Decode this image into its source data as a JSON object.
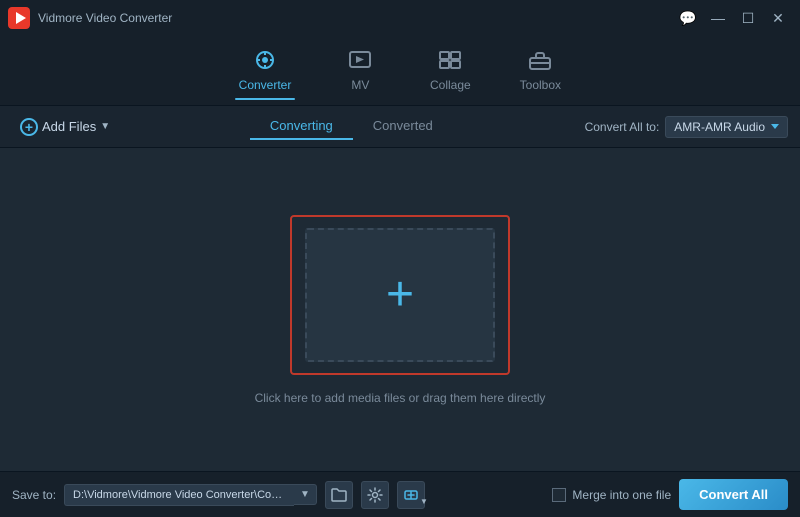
{
  "titlebar": {
    "app_name": "Vidmore Video Converter",
    "controls": {
      "message": "💬",
      "minimize": "—",
      "maximize": "☐",
      "close": "✕"
    }
  },
  "nav": {
    "tabs": [
      {
        "id": "converter",
        "label": "Converter",
        "icon": "⊙",
        "active": true
      },
      {
        "id": "mv",
        "label": "MV",
        "icon": "🖼",
        "active": false
      },
      {
        "id": "collage",
        "label": "Collage",
        "icon": "⊞",
        "active": false
      },
      {
        "id": "toolbox",
        "label": "Toolbox",
        "icon": "🧰",
        "active": false
      }
    ]
  },
  "toolbar": {
    "add_files_label": "Add Files",
    "sub_tabs": [
      {
        "id": "converting",
        "label": "Converting",
        "active": true
      },
      {
        "id": "converted",
        "label": "Converted",
        "active": false
      }
    ],
    "convert_all_to_label": "Convert All to:",
    "format": "AMR-AMR Audio",
    "format_arrow": "▼"
  },
  "main": {
    "drop_hint": "Click here to add media files or drag them here directly",
    "drop_plus": "+"
  },
  "bottombar": {
    "save_to_label": "Save to:",
    "save_path": "D:\\Vidmore\\Vidmore Video Converter\\Converted",
    "merge_label": "Merge into one file",
    "convert_all_btn": "Convert All"
  }
}
